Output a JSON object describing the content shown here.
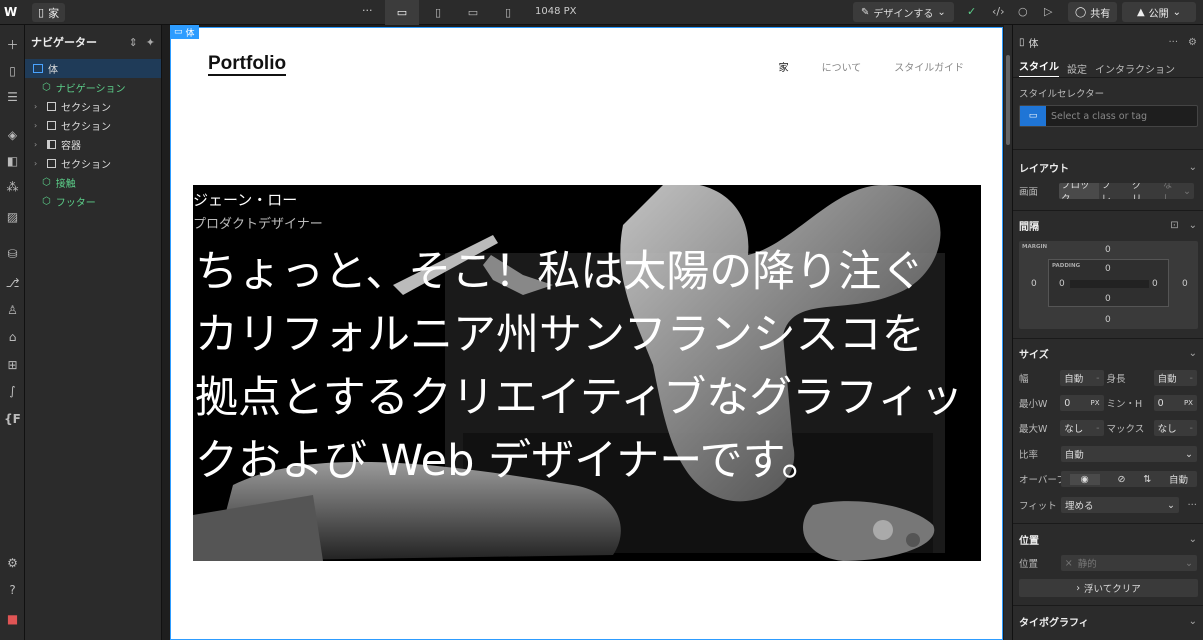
{
  "topbar": {
    "page_name": "家",
    "more": "···",
    "canvas_width": "1048 PX",
    "mode_label": "デザインする",
    "share_label": "共有",
    "publish_label": "公開"
  },
  "navigator": {
    "title": "ナビゲーター",
    "items": [
      {
        "label": "体"
      },
      {
        "label": "ナビゲーション"
      },
      {
        "label": "セクション"
      },
      {
        "label": "セクション"
      },
      {
        "label": "容器"
      },
      {
        "label": "セクション"
      },
      {
        "label": "接触"
      },
      {
        "label": "フッター"
      }
    ]
  },
  "canvas": {
    "selected_tag": "体",
    "brand": "Portfolio",
    "nav_links": [
      "家",
      "について",
      "スタイルガイド"
    ],
    "hero_name": "ジェーン・ロー",
    "hero_role": "プロダクトデザイナー",
    "hero_text": "ちょっと、そこ！私は太陽の降り注ぐカリフォルニア州サンフランシスコを拠点とするクリエイティブなグラフィックおよび Web デザイナーです。"
  },
  "panel": {
    "element_label": "体",
    "more": "···",
    "tabs": [
      "スタイル",
      "設定",
      "インタラクション"
    ],
    "style_selector_label": "スタイルセレクター",
    "style_selector_placeholder": "Select a class or tag",
    "layout_title": "レイアウト",
    "display_label": "画面",
    "display_options": [
      "ブロック",
      "フレ...",
      "グリ...",
      "なし"
    ],
    "spacing_title": "間隔",
    "margin_label": "MARGIN",
    "padding_label": "PADDING",
    "spacing_values": {
      "mt": "0",
      "ml": "0",
      "mr": "0",
      "mb": "0",
      "pt": "0",
      "pl": "0",
      "pr": "0",
      "pb": "0"
    },
    "size_title": "サイズ",
    "width_label": "幅",
    "width_value": "自動",
    "height_label": "身長",
    "height_value": "自動",
    "min_w_label": "最小W",
    "min_w_value": "0",
    "min_h_label": "ミン・H",
    "min_h_value": "0",
    "unit_px": "PX",
    "max_w_label": "最大W",
    "max_w_value": "なし",
    "max_h_label": "マックス",
    "max_h_value": "なし",
    "ratio_label": "比率",
    "ratio_value": "自動",
    "overflow_label": "オーバーフ...",
    "overflow_auto": "自動",
    "fit_label": "フィット",
    "fit_value": "埋める",
    "position_title": "位置",
    "position_label": "位置",
    "position_value": "静的",
    "float_clear_label": "浮いてクリア",
    "typography_title": "タイポグラフィ"
  }
}
